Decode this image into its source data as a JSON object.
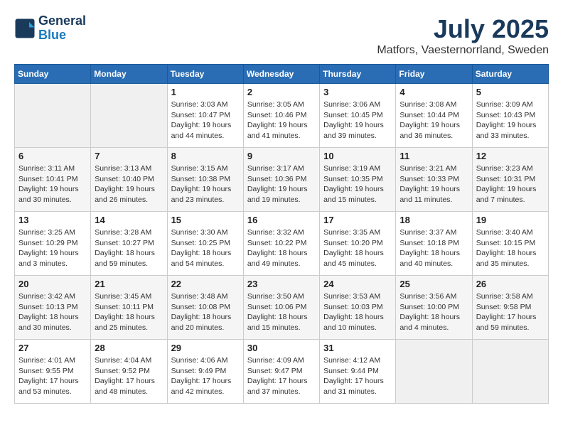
{
  "header": {
    "logo_line1": "General",
    "logo_line2": "Blue",
    "month_year": "July 2025",
    "location": "Matfors, Vaesternorrland, Sweden"
  },
  "weekdays": [
    "Sunday",
    "Monday",
    "Tuesday",
    "Wednesday",
    "Thursday",
    "Friday",
    "Saturday"
  ],
  "weeks": [
    [
      {
        "day": "",
        "empty": true
      },
      {
        "day": "",
        "empty": true
      },
      {
        "day": "1",
        "sunrise": "3:03 AM",
        "sunset": "10:47 PM",
        "daylight": "19 hours and 44 minutes."
      },
      {
        "day": "2",
        "sunrise": "3:05 AM",
        "sunset": "10:46 PM",
        "daylight": "19 hours and 41 minutes."
      },
      {
        "day": "3",
        "sunrise": "3:06 AM",
        "sunset": "10:45 PM",
        "daylight": "19 hours and 39 minutes."
      },
      {
        "day": "4",
        "sunrise": "3:08 AM",
        "sunset": "10:44 PM",
        "daylight": "19 hours and 36 minutes."
      },
      {
        "day": "5",
        "sunrise": "3:09 AM",
        "sunset": "10:43 PM",
        "daylight": "19 hours and 33 minutes."
      }
    ],
    [
      {
        "day": "6",
        "sunrise": "3:11 AM",
        "sunset": "10:41 PM",
        "daylight": "19 hours and 30 minutes."
      },
      {
        "day": "7",
        "sunrise": "3:13 AM",
        "sunset": "10:40 PM",
        "daylight": "19 hours and 26 minutes."
      },
      {
        "day": "8",
        "sunrise": "3:15 AM",
        "sunset": "10:38 PM",
        "daylight": "19 hours and 23 minutes."
      },
      {
        "day": "9",
        "sunrise": "3:17 AM",
        "sunset": "10:36 PM",
        "daylight": "19 hours and 19 minutes."
      },
      {
        "day": "10",
        "sunrise": "3:19 AM",
        "sunset": "10:35 PM",
        "daylight": "19 hours and 15 minutes."
      },
      {
        "day": "11",
        "sunrise": "3:21 AM",
        "sunset": "10:33 PM",
        "daylight": "19 hours and 11 minutes."
      },
      {
        "day": "12",
        "sunrise": "3:23 AM",
        "sunset": "10:31 PM",
        "daylight": "19 hours and 7 minutes."
      }
    ],
    [
      {
        "day": "13",
        "sunrise": "3:25 AM",
        "sunset": "10:29 PM",
        "daylight": "19 hours and 3 minutes."
      },
      {
        "day": "14",
        "sunrise": "3:28 AM",
        "sunset": "10:27 PM",
        "daylight": "18 hours and 59 minutes."
      },
      {
        "day": "15",
        "sunrise": "3:30 AM",
        "sunset": "10:25 PM",
        "daylight": "18 hours and 54 minutes."
      },
      {
        "day": "16",
        "sunrise": "3:32 AM",
        "sunset": "10:22 PM",
        "daylight": "18 hours and 49 minutes."
      },
      {
        "day": "17",
        "sunrise": "3:35 AM",
        "sunset": "10:20 PM",
        "daylight": "18 hours and 45 minutes."
      },
      {
        "day": "18",
        "sunrise": "3:37 AM",
        "sunset": "10:18 PM",
        "daylight": "18 hours and 40 minutes."
      },
      {
        "day": "19",
        "sunrise": "3:40 AM",
        "sunset": "10:15 PM",
        "daylight": "18 hours and 35 minutes."
      }
    ],
    [
      {
        "day": "20",
        "sunrise": "3:42 AM",
        "sunset": "10:13 PM",
        "daylight": "18 hours and 30 minutes."
      },
      {
        "day": "21",
        "sunrise": "3:45 AM",
        "sunset": "10:11 PM",
        "daylight": "18 hours and 25 minutes."
      },
      {
        "day": "22",
        "sunrise": "3:48 AM",
        "sunset": "10:08 PM",
        "daylight": "18 hours and 20 minutes."
      },
      {
        "day": "23",
        "sunrise": "3:50 AM",
        "sunset": "10:06 PM",
        "daylight": "18 hours and 15 minutes."
      },
      {
        "day": "24",
        "sunrise": "3:53 AM",
        "sunset": "10:03 PM",
        "daylight": "18 hours and 10 minutes."
      },
      {
        "day": "25",
        "sunrise": "3:56 AM",
        "sunset": "10:00 PM",
        "daylight": "18 hours and 4 minutes."
      },
      {
        "day": "26",
        "sunrise": "3:58 AM",
        "sunset": "9:58 PM",
        "daylight": "17 hours and 59 minutes."
      }
    ],
    [
      {
        "day": "27",
        "sunrise": "4:01 AM",
        "sunset": "9:55 PM",
        "daylight": "17 hours and 53 minutes."
      },
      {
        "day": "28",
        "sunrise": "4:04 AM",
        "sunset": "9:52 PM",
        "daylight": "17 hours and 48 minutes."
      },
      {
        "day": "29",
        "sunrise": "4:06 AM",
        "sunset": "9:49 PM",
        "daylight": "17 hours and 42 minutes."
      },
      {
        "day": "30",
        "sunrise": "4:09 AM",
        "sunset": "9:47 PM",
        "daylight": "17 hours and 37 minutes."
      },
      {
        "day": "31",
        "sunrise": "4:12 AM",
        "sunset": "9:44 PM",
        "daylight": "17 hours and 31 minutes."
      },
      {
        "day": "",
        "empty": true
      },
      {
        "day": "",
        "empty": true
      }
    ]
  ]
}
